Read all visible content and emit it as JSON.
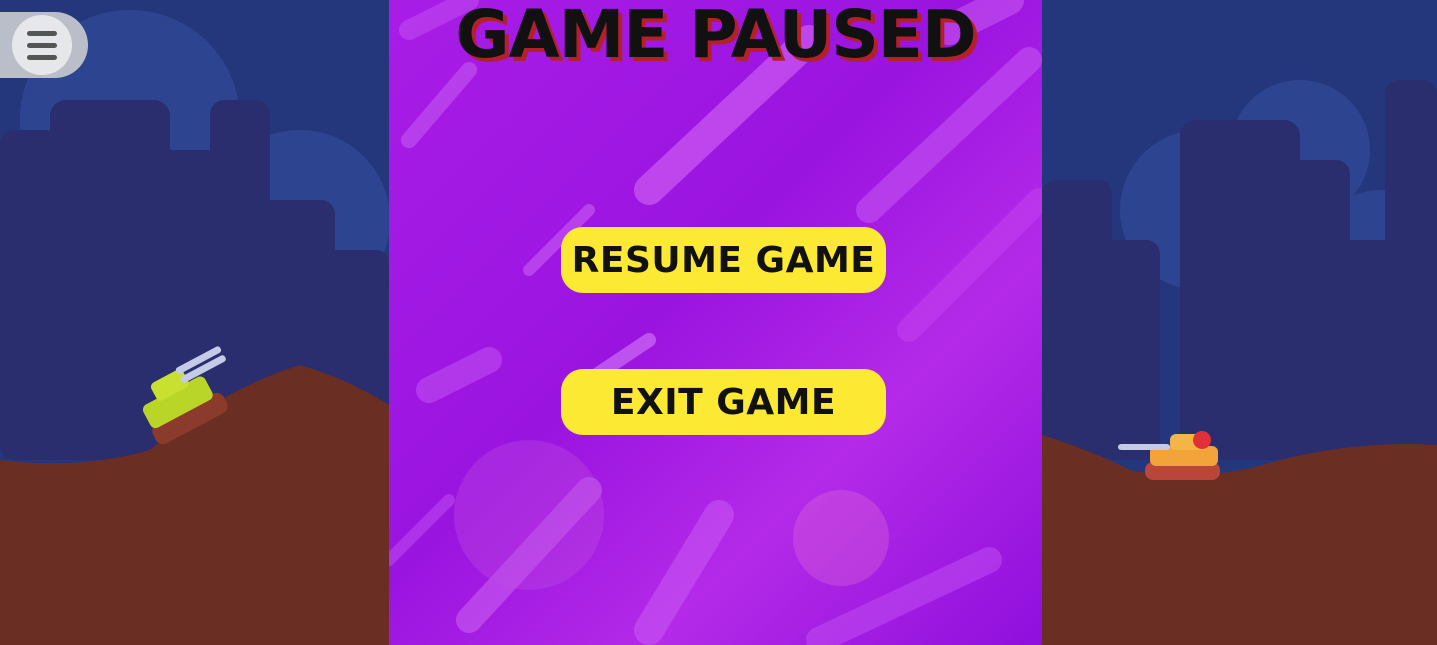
{
  "menu": {
    "icon": "hamburger-menu-icon"
  },
  "pause_menu": {
    "title": "GAME PAUSED",
    "resume_label": "RESUME GAME",
    "exit_label": "EXIT GAME"
  },
  "colors": {
    "sky": "#25377c",
    "city_back": "#2d3f88",
    "city_front": "#2a2d6e",
    "ground": "#6b2e22",
    "panel_purple": "#a81de6",
    "button_yellow": "#fbe933",
    "title_shadow": "#b3202a"
  },
  "tanks": {
    "left": "green-tank-icon",
    "right": "orange-tank-icon"
  }
}
